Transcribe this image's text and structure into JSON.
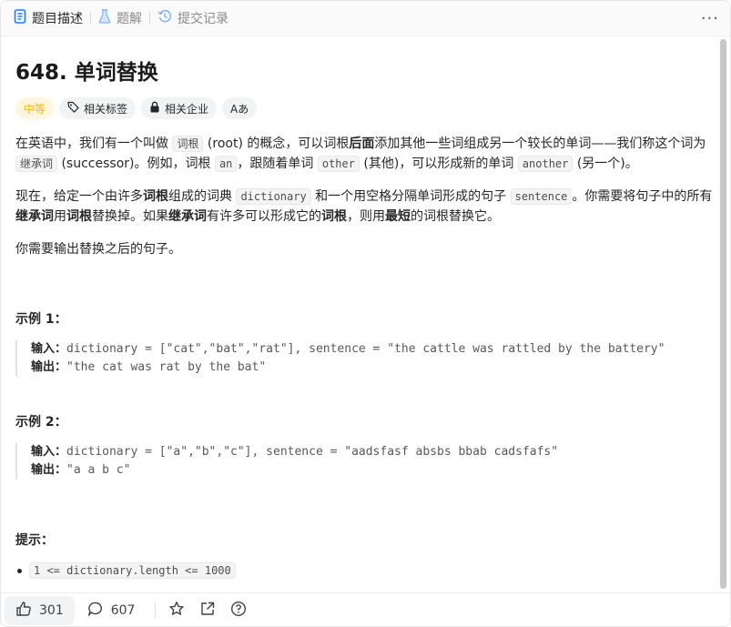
{
  "tabs": [
    {
      "label": "题目描述",
      "icon": "document-icon",
      "active": true
    },
    {
      "label": "题解",
      "icon": "flask-icon",
      "active": false
    },
    {
      "label": "提交记录",
      "icon": "history-icon",
      "active": false
    }
  ],
  "more_label": "···",
  "problem": {
    "title": "648. 单词替换",
    "tags": {
      "difficulty": "中等",
      "related_tags": "相关标签",
      "related_companies": "相关企业",
      "font_toggle": "Aあ"
    }
  },
  "description": {
    "p1": {
      "a": "在英语中，我们有一个叫做 ",
      "code1": "词根",
      "b": " (root) 的概念，可以词根",
      "bold1": "后面",
      "c": "添加其他一些词组成另一个较长的单词——我们称这个词为 ",
      "code2": "继承词",
      "d": " (successor)。例如，词根 ",
      "code3": "an",
      "e": "，跟随着单词 ",
      "code4": "other",
      "f": " (其他)，可以形成新的单词 ",
      "code5": "another",
      "g": " (另一个)。"
    },
    "p2": {
      "a": "现在，给定一个由许多",
      "bold1": "词根",
      "b": "组成的词典 ",
      "code1": "dictionary",
      "c": " 和一个用空格分隔单词形成的句子 ",
      "code2": "sentence",
      "d": "。你需要将句子中的所有",
      "bold2": "继承词",
      "e": "用",
      "bold3": "词根",
      "f": "替换掉。如果",
      "bold4": "继承词",
      "g": "有许多可以形成它的",
      "bold5": "词根",
      "h": "，则用",
      "bold6": "最短",
      "i": "的词根替换它。"
    },
    "p3": "你需要输出替换之后的句子。"
  },
  "examples": [
    {
      "heading": "示例 1：",
      "input_label": "输入：",
      "input": "dictionary = [\"cat\",\"bat\",\"rat\"], sentence = \"the cattle was rattled by the battery\"",
      "output_label": "输出：",
      "output": "\"the cat was rat by the bat\""
    },
    {
      "heading": "示例 2：",
      "input_label": "输入：",
      "input": "dictionary = [\"a\",\"b\",\"c\"], sentence = \"aadsfasf absbs bbab cadsfafs\"",
      "output_label": "输出：",
      "output": "\"a a b c\""
    }
  ],
  "hints": {
    "heading": "提示：",
    "items": [
      "1 <= dictionary.length <= 1000"
    ]
  },
  "footer": {
    "likes": "301",
    "comments": "607",
    "icons": [
      "thumbs-up-icon",
      "comment-icon",
      "star-icon",
      "share-icon",
      "help-icon"
    ]
  },
  "colors": {
    "difficulty_medium": "#ffb800",
    "tab_active": "#262626",
    "tab_inactive": "#8a8a8a"
  }
}
